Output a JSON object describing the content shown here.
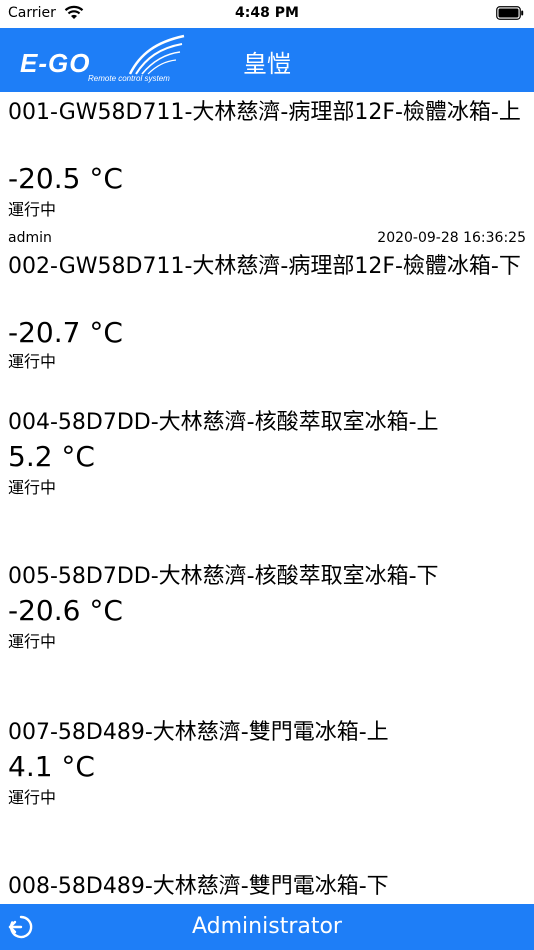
{
  "status_bar": {
    "carrier": "Carrier",
    "time": "4:48 PM"
  },
  "nav": {
    "logo_text": "E-GO",
    "logo_sub": "Remote control system",
    "title": "皇愷"
  },
  "items": [
    {
      "name": "001-GW58D711-大林慈濟-病理部12F-檢體冰箱-上",
      "temp": "-20.5 °C",
      "status": "運行中",
      "user": "admin",
      "timestamp": "2020-09-28 16:36:25"
    },
    {
      "name": "002-GW58D711-大林慈濟-病理部12F-檢體冰箱-下",
      "temp": "-20.7 °C",
      "status": "運行中"
    },
    {
      "name": "004-58D7DD-大林慈濟-核酸萃取室冰箱-上",
      "temp": "5.2 °C",
      "status": "運行中"
    },
    {
      "name": "005-58D7DD-大林慈濟-核酸萃取室冰箱-下",
      "temp": "-20.6 °C",
      "status": "運行中"
    },
    {
      "name": "007-58D489-大林慈濟-雙門電冰箱-上",
      "temp": "4.1 °C",
      "status": "運行中"
    },
    {
      "name": "008-58D489-大林慈濟-雙門電冰箱-下"
    }
  ],
  "bottom": {
    "title": "Administrator"
  },
  "colors": {
    "accent": "#1e7ef7"
  }
}
